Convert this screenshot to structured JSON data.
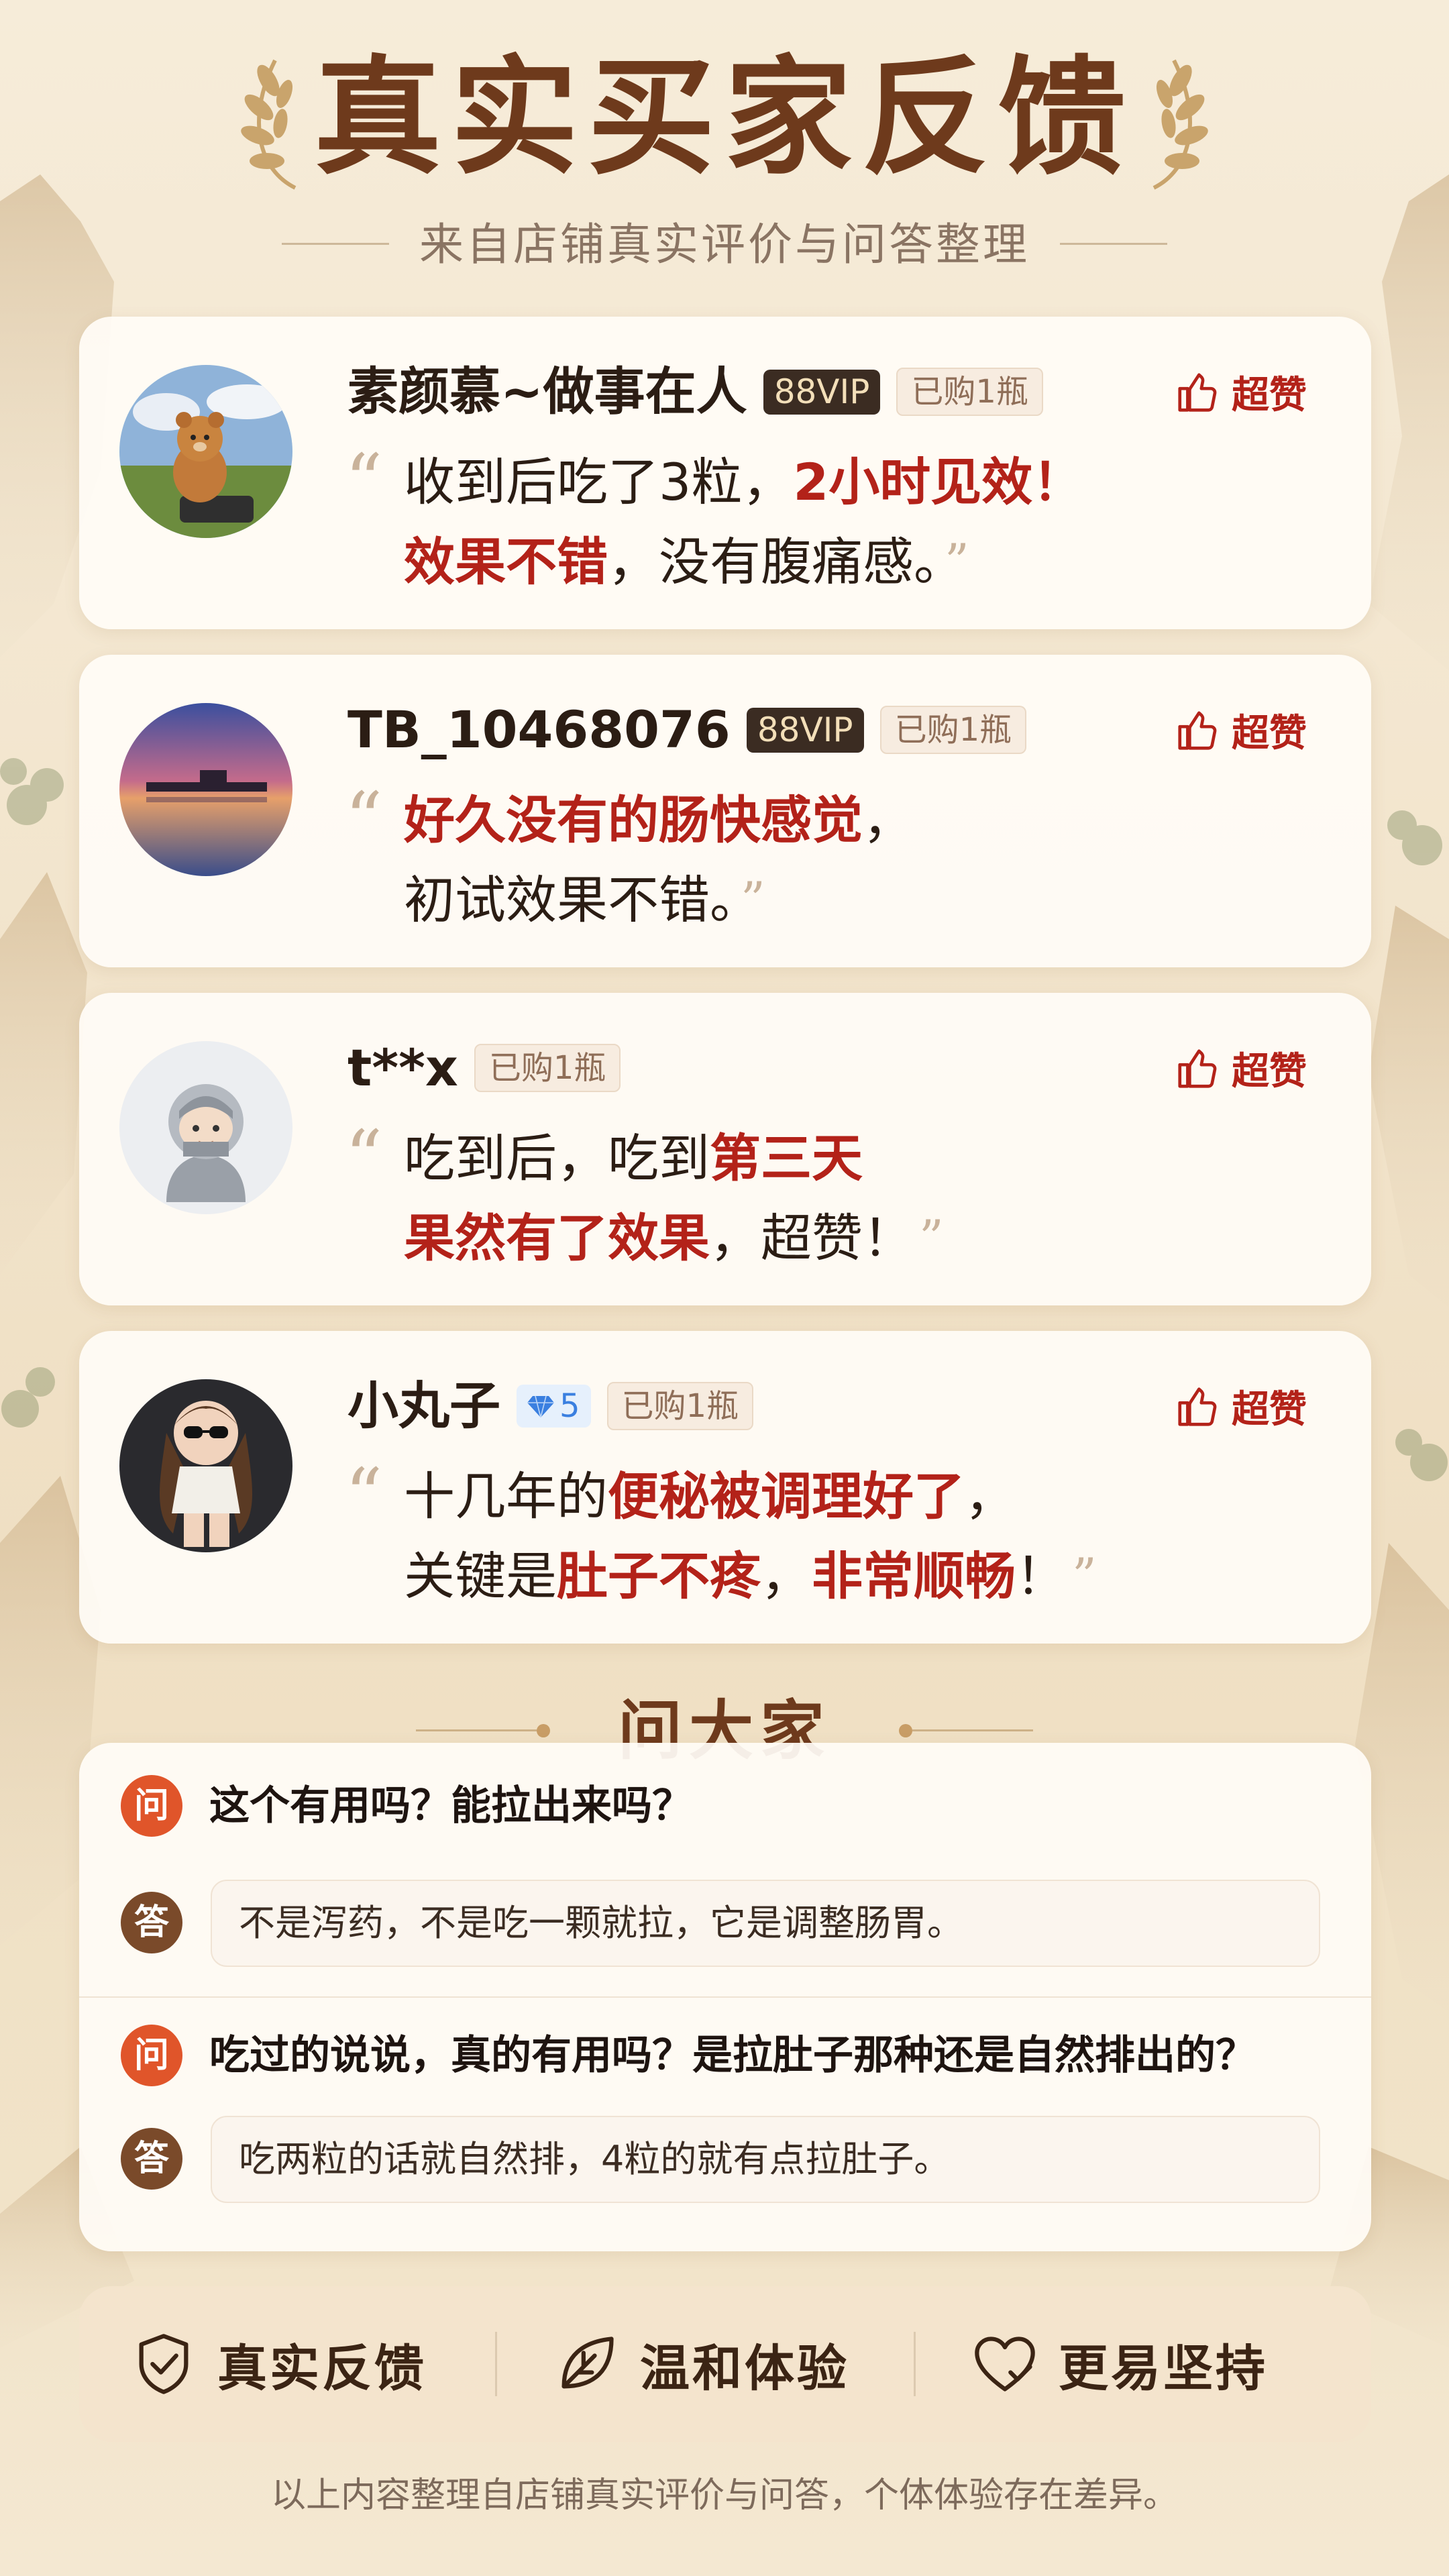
{
  "header": {
    "title": "真实买家反馈",
    "subtitle": "来自店铺真实评价与问答整理"
  },
  "reviews": [
    {
      "username": "素颜慕~做事在人",
      "badge": "88VIP",
      "bought": "已购1瓶",
      "like_label": "超赞",
      "avatar_icon": "bear-toy-avatar",
      "line1": [
        "收到后吃了3粒，",
        "2小时见效！"
      ],
      "line2": [
        "效果不错",
        "，没有腹痛感。"
      ]
    },
    {
      "username": "TB_10468076",
      "badge": "88VIP",
      "bought": "已购1瓶",
      "like_label": "超赞",
      "avatar_icon": "sunset-lake-avatar",
      "line1": [
        "好久没有的肠快感觉",
        "，"
      ],
      "line2": [
        "初试效果不错。"
      ]
    },
    {
      "username": "t**x",
      "bought": "已购1瓶",
      "like_label": "超赞",
      "avatar_icon": "default-user-avatar",
      "line1": [
        "吃到后，吃到",
        "第三天"
      ],
      "line2": [
        "果然有了效果",
        "，超赞！"
      ]
    },
    {
      "username": "小丸子",
      "level": "5",
      "bought": "已购1瓶",
      "like_label": "超赞",
      "avatar_icon": "girl-sunglasses-avatar",
      "line1": [
        "十几年的",
        "便秘被调理好了",
        "，"
      ],
      "line2": [
        "关键是",
        "肚子不疼",
        "，",
        "非常顺畅",
        "！"
      ]
    }
  ],
  "ask": {
    "title": "问大家",
    "q_badge": "问",
    "a_badge": "答",
    "items": [
      {
        "question": "这个有用吗？能拉出来吗？",
        "answer": "不是泻药，不是吃一颗就拉，它是调整肠胃。"
      },
      {
        "question": "吃过的说说，真的有用吗？是拉肚子那种还是自然排出的？",
        "answer": "吃两粒的话就自然排，4粒的就有点拉肚子。"
      }
    ]
  },
  "features": [
    {
      "label": "真实反馈",
      "icon": "shield-check-icon"
    },
    {
      "label": "温和体验",
      "icon": "leaf-icon"
    },
    {
      "label": "更易坚持",
      "icon": "heart-check-icon"
    }
  ],
  "footer": "以上内容整理自店铺真实评价与问答，个体体验存在差异。",
  "colors": {
    "accent_red": "#b32219",
    "title_brown": "#6e3a1c",
    "question_orange": "#e0552a",
    "answer_brown": "#7a4a2a"
  }
}
